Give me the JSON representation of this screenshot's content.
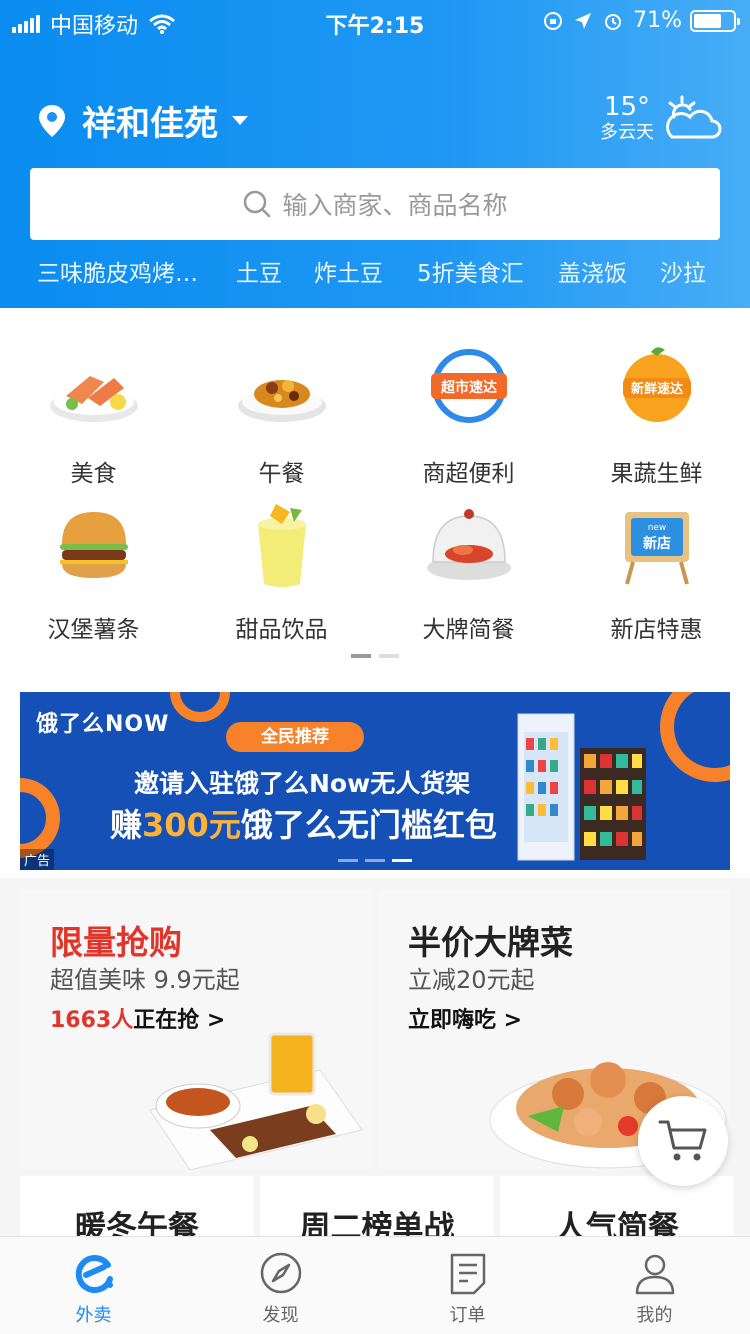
{
  "status_bar": {
    "carrier": "中国移动",
    "time": "下午2:15",
    "battery": "71%"
  },
  "header": {
    "location": "祥和佳苑",
    "weather_temp": "15°",
    "weather_desc": "多云天",
    "search_placeholder": "输入商家、商品名称",
    "hot_words": [
      "三味脆皮鸡烤…",
      "土豆",
      "炸土豆",
      "5折美食汇",
      "盖浇饭",
      "沙拉"
    ]
  },
  "categories": [
    {
      "label": "美食",
      "icon": "salmon-dish-icon"
    },
    {
      "label": "午餐",
      "icon": "rice-bowl-icon"
    },
    {
      "label": "商超便利",
      "icon": "supermarket-express-icon"
    },
    {
      "label": "果蔬生鲜",
      "icon": "fresh-express-icon"
    },
    {
      "label": "汉堡薯条",
      "icon": "burger-icon"
    },
    {
      "label": "甜品饮品",
      "icon": "drink-icon"
    },
    {
      "label": "大牌简餐",
      "icon": "cloche-dish-icon"
    },
    {
      "label": "新店特惠",
      "icon": "new-store-icon"
    }
  ],
  "category_icon_text": {
    "supermarket": "超市速达",
    "fresh": "新鲜速达",
    "new_store_small": "new",
    "new_store": "新店"
  },
  "banner": {
    "logo": "饿了么NOW",
    "tag": "全民推荐",
    "line1": "邀请入驻饿了么Now无人货架",
    "line2_prefix": "赚",
    "line2_amount": "300元",
    "line2_suffix": "饿了么无门槛红包",
    "ad_label": "广告"
  },
  "promos": {
    "left": {
      "title": "限量抢购",
      "subtitle": "超值美味 9.9元起",
      "count": "1663人",
      "cta": "正在抢 >"
    },
    "right": {
      "title": "半价大牌菜",
      "subtitle": "立减20元起",
      "cta": "立即嗨吃 >"
    }
  },
  "small_cards": [
    "暖冬午餐",
    "周二榜单战",
    "人气简餐"
  ],
  "tabs": [
    {
      "label": "外卖",
      "icon": "eleme-logo-icon",
      "active": true
    },
    {
      "label": "发现",
      "icon": "compass-icon",
      "active": false
    },
    {
      "label": "订单",
      "icon": "order-list-icon",
      "active": false
    },
    {
      "label": "我的",
      "icon": "profile-icon",
      "active": false
    }
  ],
  "colors": {
    "header_blue": "#1a93f3",
    "accent_red": "#e0352b",
    "tab_active": "#1e8bf5",
    "banner_blue": "#1450b5",
    "banner_orange": "#f8822a"
  }
}
